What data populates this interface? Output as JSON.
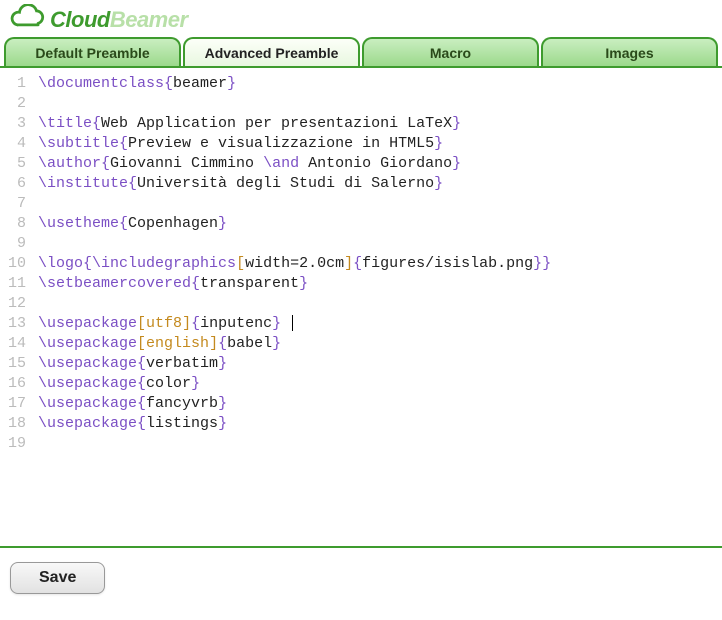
{
  "app": {
    "logo_part1": "Cloud",
    "logo_part2": "Beamer"
  },
  "tabs": [
    {
      "label": "Default Preamble",
      "active": false
    },
    {
      "label": "Advanced Preamble",
      "active": true
    },
    {
      "label": "Macro",
      "active": false
    },
    {
      "label": "Images",
      "active": false
    }
  ],
  "editor": {
    "cursor_line": 13,
    "lines": [
      {
        "n": 1,
        "tokens": [
          [
            "cmd",
            "\\documentclass"
          ],
          [
            "brace",
            "{"
          ],
          [
            "txt",
            "beamer"
          ],
          [
            "brace",
            "}"
          ]
        ]
      },
      {
        "n": 2,
        "tokens": []
      },
      {
        "n": 3,
        "tokens": [
          [
            "cmd",
            "\\title"
          ],
          [
            "brace",
            "{"
          ],
          [
            "txt",
            "Web Application per presentazioni LaTeX"
          ],
          [
            "brace",
            "}"
          ]
        ]
      },
      {
        "n": 4,
        "tokens": [
          [
            "cmd",
            "\\subtitle"
          ],
          [
            "brace",
            "{"
          ],
          [
            "txt",
            "Preview e visualizzazione in HTML5"
          ],
          [
            "brace",
            "}"
          ]
        ]
      },
      {
        "n": 5,
        "tokens": [
          [
            "cmd",
            "\\author"
          ],
          [
            "brace",
            "{"
          ],
          [
            "txt",
            "Giovanni Cimmino "
          ],
          [
            "cmd",
            "\\and"
          ],
          [
            "txt",
            " Antonio Giordano"
          ],
          [
            "brace",
            "}"
          ]
        ]
      },
      {
        "n": 6,
        "tokens": [
          [
            "cmd",
            "\\institute"
          ],
          [
            "brace",
            "{"
          ],
          [
            "txt",
            "Università degli Studi di Salerno"
          ],
          [
            "brace",
            "}"
          ]
        ]
      },
      {
        "n": 7,
        "tokens": []
      },
      {
        "n": 8,
        "tokens": [
          [
            "cmd",
            "\\usetheme"
          ],
          [
            "brace",
            "{"
          ],
          [
            "txt",
            "Copenhagen"
          ],
          [
            "brace",
            "}"
          ]
        ]
      },
      {
        "n": 9,
        "tokens": []
      },
      {
        "n": 10,
        "tokens": [
          [
            "cmd",
            "\\logo"
          ],
          [
            "brace",
            "{"
          ],
          [
            "cmd",
            "\\includegraphics"
          ],
          [
            "bracket",
            "["
          ],
          [
            "txt",
            "width=2.0cm"
          ],
          [
            "bracket",
            "]"
          ],
          [
            "brace",
            "{"
          ],
          [
            "txt",
            "figures/isislab.png"
          ],
          [
            "brace",
            "}"
          ],
          [
            "brace",
            "}"
          ]
        ]
      },
      {
        "n": 11,
        "tokens": [
          [
            "cmd",
            "\\setbeamercovered"
          ],
          [
            "brace",
            "{"
          ],
          [
            "txt",
            "transparent"
          ],
          [
            "brace",
            "}"
          ]
        ]
      },
      {
        "n": 12,
        "tokens": []
      },
      {
        "n": 13,
        "tokens": [
          [
            "cmd",
            "\\usepackage"
          ],
          [
            "bracket",
            "["
          ],
          [
            "opt",
            "utf8"
          ],
          [
            "bracket",
            "]"
          ],
          [
            "brace",
            "{"
          ],
          [
            "txt",
            "inputenc"
          ],
          [
            "brace",
            "}"
          ]
        ]
      },
      {
        "n": 14,
        "tokens": [
          [
            "cmd",
            "\\usepackage"
          ],
          [
            "bracket",
            "["
          ],
          [
            "opt",
            "english"
          ],
          [
            "bracket",
            "]"
          ],
          [
            "brace",
            "{"
          ],
          [
            "txt",
            "babel"
          ],
          [
            "brace",
            "}"
          ]
        ]
      },
      {
        "n": 15,
        "tokens": [
          [
            "cmd",
            "\\usepackage"
          ],
          [
            "brace",
            "{"
          ],
          [
            "txt",
            "verbatim"
          ],
          [
            "brace",
            "}"
          ]
        ]
      },
      {
        "n": 16,
        "tokens": [
          [
            "cmd",
            "\\usepackage"
          ],
          [
            "brace",
            "{"
          ],
          [
            "txt",
            "color"
          ],
          [
            "brace",
            "}"
          ]
        ]
      },
      {
        "n": 17,
        "tokens": [
          [
            "cmd",
            "\\usepackage"
          ],
          [
            "brace",
            "{"
          ],
          [
            "txt",
            "fancyvrb"
          ],
          [
            "brace",
            "}"
          ]
        ]
      },
      {
        "n": 18,
        "tokens": [
          [
            "cmd",
            "\\usepackage"
          ],
          [
            "brace",
            "{"
          ],
          [
            "txt",
            "listings"
          ],
          [
            "brace",
            "}"
          ]
        ]
      },
      {
        "n": 19,
        "tokens": []
      }
    ]
  },
  "footer": {
    "save_label": "Save"
  }
}
